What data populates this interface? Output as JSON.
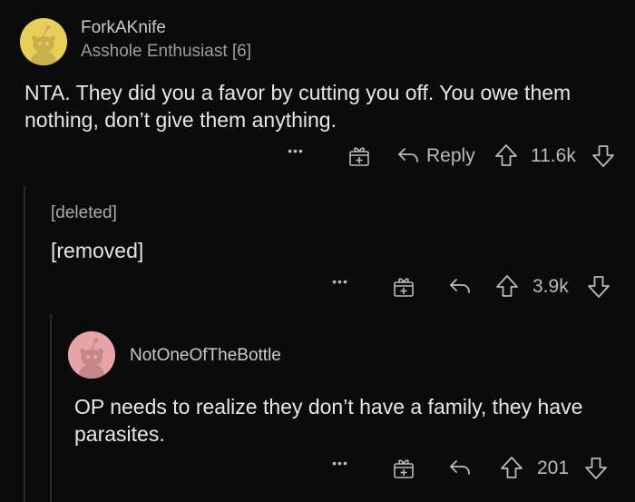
{
  "comments": [
    {
      "username": "ForkAKnife",
      "flair": "Asshole Enthusiast [6]",
      "avatar_color": "#e9cf5a",
      "body": "NTA. They did you a favor by cutting you off. You owe them nothing, don’t give them anything.",
      "actions": {
        "more_label": "•••",
        "reply_label": "Reply",
        "score": "11.6k"
      }
    },
    {
      "username": "[deleted]",
      "body": "[removed]",
      "actions": {
        "more_label": "•••",
        "score": "3.9k"
      }
    },
    {
      "username": "NotOneOfTheBottle",
      "avatar_color": "#e8a3a6",
      "body": "OP needs to realize they don’t have a family, they have parasites.",
      "actions": {
        "more_label": "•••",
        "score": "201"
      }
    }
  ],
  "icons": {
    "more": "more-dots-icon",
    "award": "gift-award-icon",
    "reply": "reply-arrow-icon",
    "upvote": "upvote-arrow-icon",
    "downvote": "downvote-arrow-icon"
  }
}
